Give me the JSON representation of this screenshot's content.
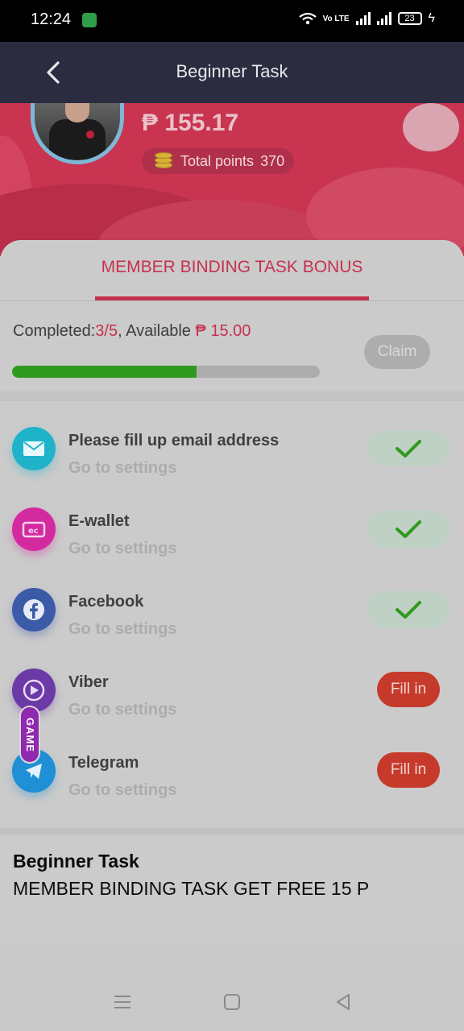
{
  "status_bar": {
    "time": "12:24",
    "volte": "Vo LTE",
    "battery": "23"
  },
  "header": {
    "title": "Beginner Task"
  },
  "profile": {
    "balance": "₱ 155.17",
    "points_label": "Total points",
    "points_value": "370"
  },
  "tabs": [
    {
      "label": "MEMBER BINDING TASK BONUS",
      "active": true
    }
  ],
  "progress": {
    "completed_label": "Completed:",
    "completed_value": "3/5",
    "available_label": ", Available ",
    "available_value": "₱ 15.00",
    "fraction": 0.6,
    "claim_label": "Claim"
  },
  "tasks": [
    {
      "title": "Please fill up email address",
      "subtitle": "Go to settings",
      "status": "done",
      "icon": "email-icon",
      "color": "#1fb3c9"
    },
    {
      "title": "E-wallet",
      "subtitle": "Go to settings",
      "status": "done",
      "icon": "wallet-icon",
      "color": "#d42aa0"
    },
    {
      "title": "Facebook",
      "subtitle": "Go to settings",
      "status": "done",
      "icon": "facebook-icon",
      "color": "#3b5aa8"
    },
    {
      "title": "Viber",
      "subtitle": "Go to settings",
      "status": "pending",
      "action_label": "Fill in",
      "icon": "viber-icon",
      "color": "#6c3aa6"
    },
    {
      "title": "Telegram",
      "subtitle": "Go to settings",
      "status": "pending",
      "action_label": "Fill in",
      "icon": "telegram-icon",
      "color": "#1f8fd6"
    }
  ],
  "game_tab": {
    "label": "GAME"
  },
  "info": {
    "title": "Beginner Task",
    "description": "MEMBER BINDING TASK GET FREE 15 P"
  },
  "colors": {
    "accent": "#c6304f",
    "header_bg": "#2c2c40",
    "progress": "#2f9a1d",
    "fill_button": "#c63a2c"
  }
}
